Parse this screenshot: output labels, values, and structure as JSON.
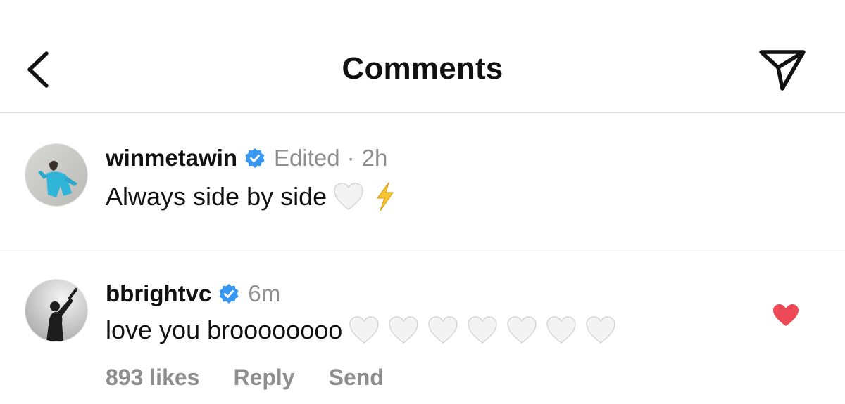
{
  "header": {
    "title": "Comments",
    "back_icon": "chevron-left-icon",
    "send_icon": "paper-plane-icon"
  },
  "comments": [
    {
      "username": "winmetawin",
      "verified": true,
      "edited": "Edited",
      "separator": "·",
      "time": "2h",
      "text": "Always side by side",
      "emojis": [
        "white-heart",
        "lightning"
      ]
    },
    {
      "username": "bbrightvc",
      "verified": true,
      "time": "6m",
      "text": "love you broooooooo",
      "emojis": [
        "white-heart",
        "white-heart",
        "white-heart",
        "white-heart",
        "white-heart",
        "white-heart",
        "white-heart"
      ],
      "liked": true,
      "likes": "893 likes",
      "reply_label": "Reply",
      "send_label": "Send"
    }
  ],
  "colors": {
    "verified_blue": "#3897f0",
    "like_red": "#ed4956",
    "muted_gray": "#8e8e8e",
    "divider": "#dcdcdc"
  }
}
